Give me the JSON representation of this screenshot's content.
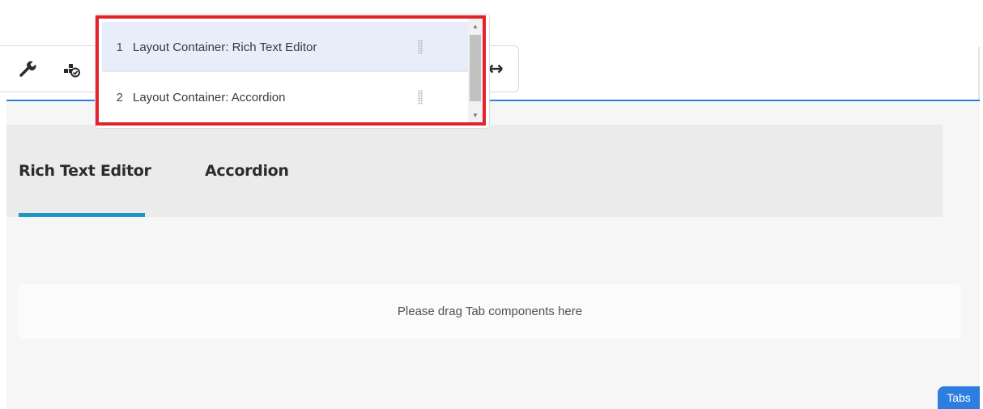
{
  "toolbar": {
    "icons": [
      {
        "name": "wrench-icon",
        "label": "Configure"
      },
      {
        "name": "policy-icon",
        "label": "Policy"
      },
      {
        "name": "resize-icon",
        "label": "Layout"
      }
    ]
  },
  "panel_selector": {
    "items": [
      {
        "number": "1",
        "label": "Layout Container: Rich Text Editor",
        "selected": true
      },
      {
        "number": "2",
        "label": "Layout Container: Accordion",
        "selected": false
      }
    ],
    "highlight_color": "#e3232c"
  },
  "tabs": {
    "items": [
      {
        "label": "Rich Text Editor",
        "active": true
      },
      {
        "label": "Accordion",
        "active": false
      }
    ],
    "active_color": "#1e96c8"
  },
  "drop_zone": {
    "text": "Please drag Tab components here"
  },
  "component_badge": {
    "label": "Tabs"
  },
  "colors": {
    "accent": "#2d7ee0"
  }
}
